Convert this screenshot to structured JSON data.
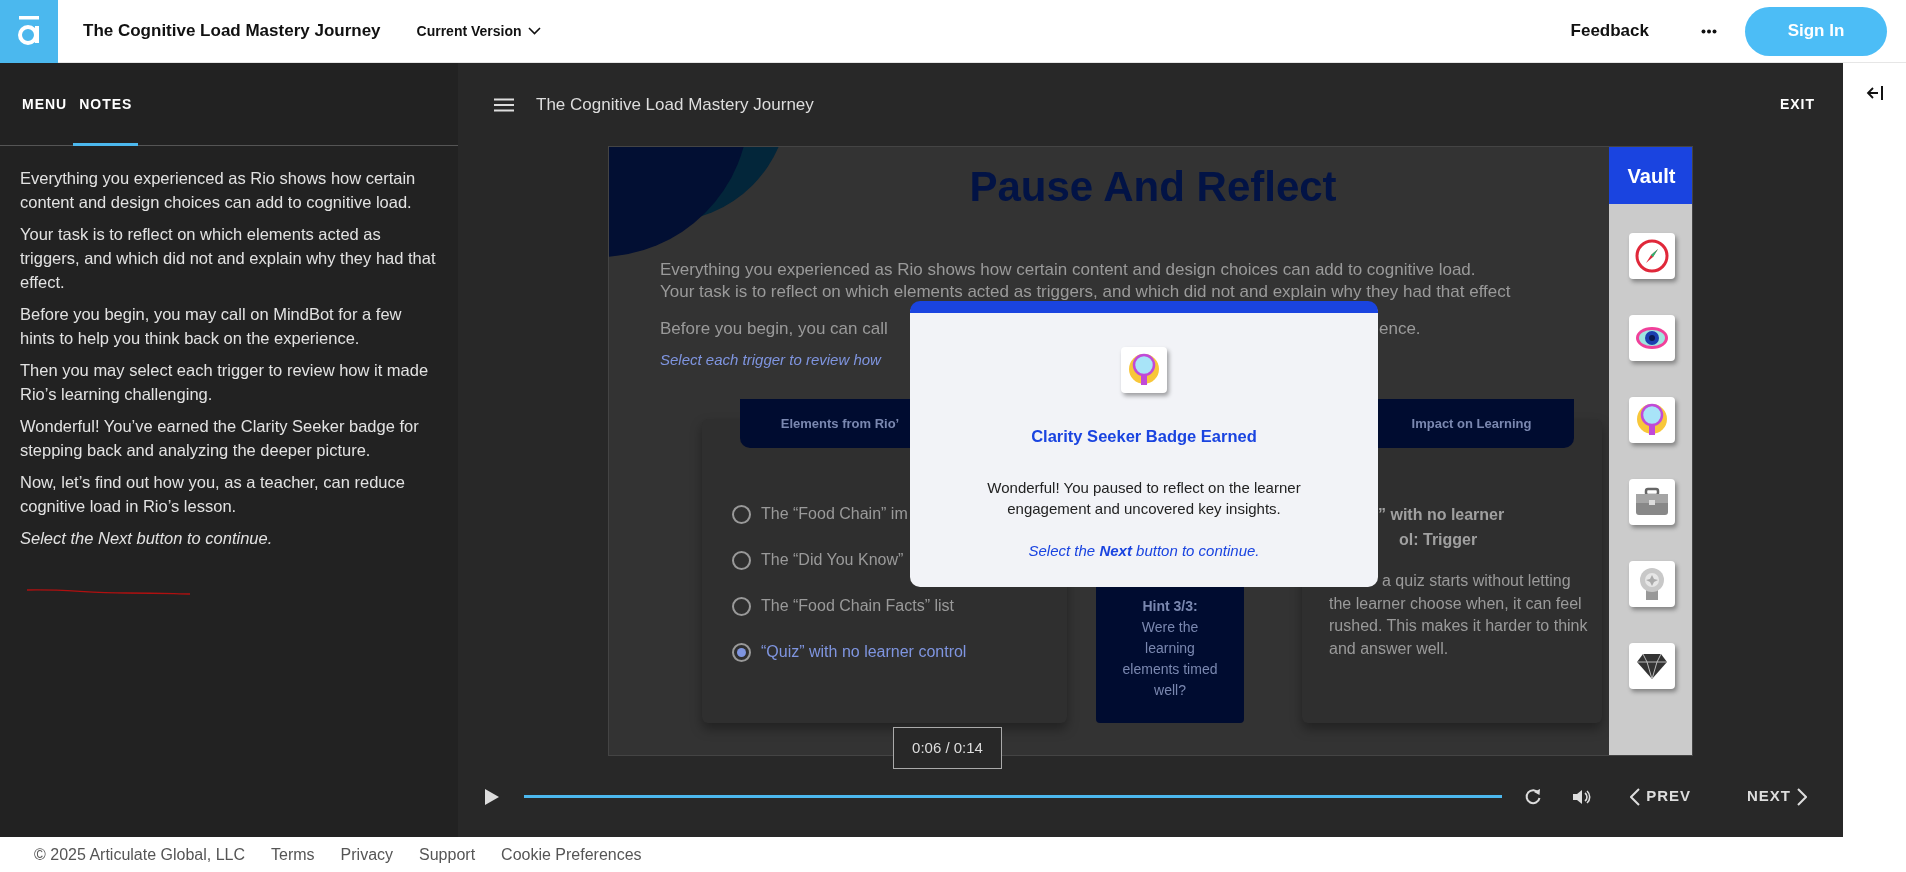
{
  "header": {
    "title": "The Cognitive Load Mastery Journey",
    "version_menu": "Current Version",
    "feedback": "Feedback",
    "sign_in": "Sign In"
  },
  "sidebar": {
    "tabs": [
      {
        "label": "MENU",
        "selected": false
      },
      {
        "label": "NOTES",
        "selected": true
      }
    ],
    "notes": [
      {
        "kind": "text",
        "text": "Everything you experienced as Rio shows how certain content and design choices can add to cognitive load."
      },
      {
        "kind": "text",
        "text": "Your task is to reflect on which elements acted as triggers, and which did not and explain why they had that effect."
      },
      {
        "kind": "text",
        "text": "Before you begin, you may call on MindBot for a few hints to help you think back on the experience."
      },
      {
        "kind": "text",
        "text": "Then you may select each trigger to review how it made Rio’s learning challenging."
      },
      {
        "kind": "text",
        "text": "Wonderful! You’ve earned the Clarity Seeker badge for stepping back and analyzing the deeper picture."
      },
      {
        "kind": "text",
        "text": "Now, let’s find out how you, as a teacher, can reduce cognitive load in Rio’s lesson."
      },
      {
        "kind": "instruction",
        "text": "Select the Next button to continue."
      }
    ]
  },
  "player": {
    "title": "The Cognitive Load Mastery Journey",
    "exit": "EXIT",
    "slide": {
      "title": "Pause And Reflect",
      "intro": [
        "Everything you experienced as Rio shows how certain content and design choices can add to cognitive load.",
        "Your task is to reflect on which elements acted as triggers, and which did not and explain why they had that effect"
      ],
      "call_line_start": "Before you begin, you can call",
      "call_line_end": "ence.",
      "instruction": "Select each trigger to review how",
      "left_card": {
        "header": "Elements from Rio’",
        "options": [
          {
            "label": "The “Food Chain” im",
            "selected": false
          },
          {
            "label": "The “Did You Know”",
            "selected": false
          },
          {
            "label": "The “Food Chain Facts” list",
            "selected": false
          },
          {
            "label": "“Quiz” with no learner control",
            "selected": true
          }
        ]
      },
      "hint": {
        "title": "Hint 3/3:",
        "text": "Were the learning elements timed well?"
      },
      "right_card": {
        "header": "Impact on Learning",
        "heading_1": "” with no learner",
        "heading_2": "ol: Trigger",
        "body": "a quiz starts without letting the learner choose when, it can feel rushed. This makes it harder to think and answer well."
      },
      "vault": {
        "title": "Vault",
        "badges": [
          {
            "kind": "compass"
          },
          {
            "kind": "eye"
          },
          {
            "kind": "magnifier"
          },
          {
            "kind": "briefcase"
          },
          {
            "kind": "medal"
          },
          {
            "kind": "gem"
          }
        ]
      }
    },
    "modal": {
      "badge": {
        "kind": "magnifier"
      },
      "title": "Clarity Seeker Badge Earned",
      "message": "Wonderful! You paused to reflect on the learner engagement and uncovered key insights.",
      "prompt": "Select the **Next** button to continue."
    },
    "timestamp": "0:06 / 0:14",
    "progress": {
      "level": 1
    },
    "prev": "PREV",
    "next": "NEXT"
  },
  "footer": {
    "copyright": "© 2025 Articulate Global, LLC",
    "links": [
      "Terms",
      "Privacy",
      "Support",
      "Cookie Preferences"
    ]
  }
}
